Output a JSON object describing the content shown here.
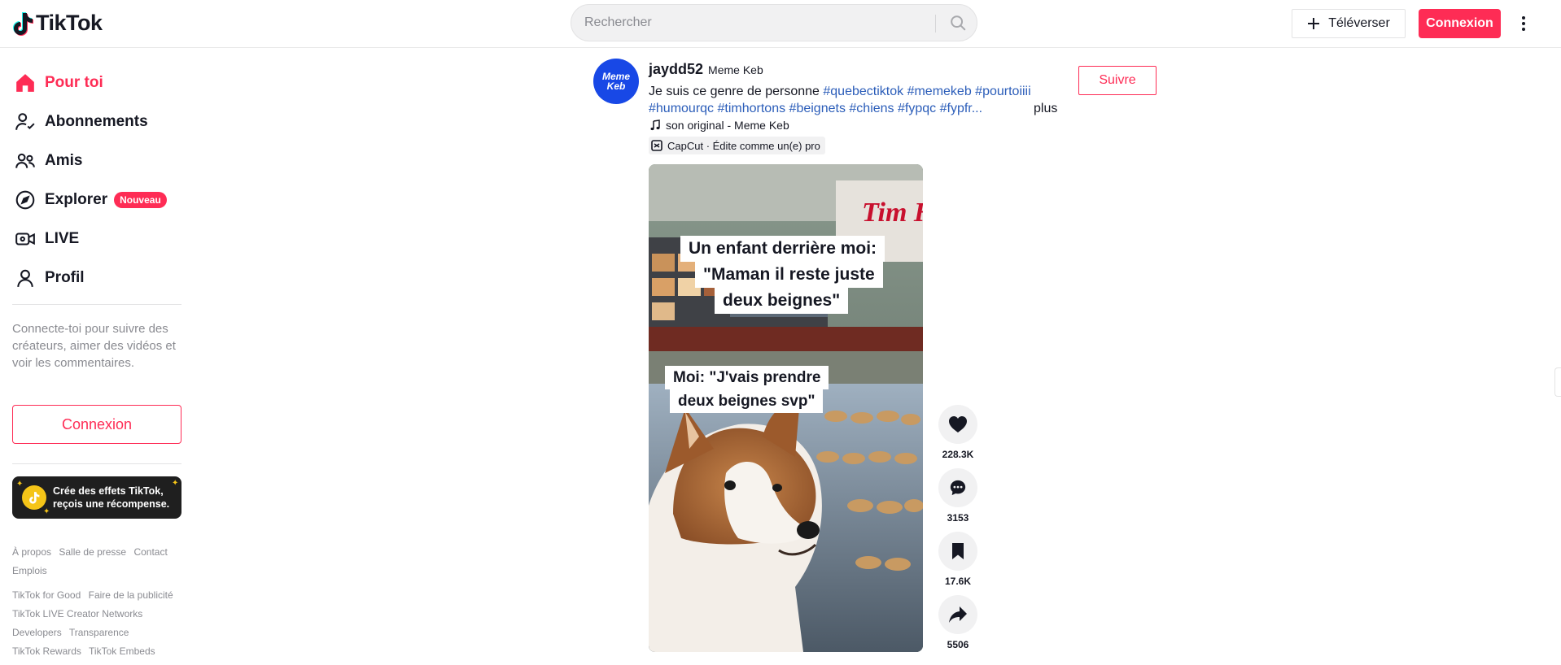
{
  "header": {
    "logo_text": "TikTok",
    "search_placeholder": "Rechercher",
    "upload_label": "Téléverser",
    "login_label": "Connexion"
  },
  "sidebar": {
    "nav": [
      {
        "label": "Pour toi",
        "icon": "home-icon",
        "active": true
      },
      {
        "label": "Abonnements",
        "icon": "following-icon"
      },
      {
        "label": "Amis",
        "icon": "friends-icon"
      },
      {
        "label": "Explorer",
        "icon": "compass-icon",
        "badge": "Nouveau"
      },
      {
        "label": "LIVE",
        "icon": "live-icon"
      },
      {
        "label": "Profil",
        "icon": "profile-icon"
      }
    ],
    "login_hint": "Connecte-toi pour suivre des créateurs, aimer des vidéos et voir les commentaires.",
    "login_button": "Connexion",
    "promo": "Crée des effets TikTok, reçois une récompense.",
    "footer": {
      "row1": [
        "À propos",
        "Salle de presse",
        "Contact",
        "Emplois"
      ],
      "row2": [
        "TikTok for Good",
        "Faire de la publicité",
        "TikTok LIVE Creator Networks",
        "Developers",
        "Transparence",
        "TikTok Rewards",
        "TikTok Embeds"
      ]
    }
  },
  "post": {
    "avatar_text": "Meme Keb",
    "author_id": "jaydd52",
    "author_nick": "Meme Keb",
    "desc_text": "Je suis ce genre de personne",
    "hashtags": [
      "#quebectiktok",
      "#memekeb",
      "#pourtoiiii",
      "#humourqc",
      "#timhortons",
      "#beignets",
      "#chiens",
      "#fypqc",
      "#fypfr..."
    ],
    "more_label": "plus",
    "music": "son original - Meme Keb",
    "capcut": "CapCut · Édite comme un(e) pro",
    "follow_label": "Suivre",
    "video": {
      "caption1": "Un enfant derrière moi: \"Maman il reste juste deux beignes\"",
      "caption1_lines": [
        "Un enfant derrière moi:",
        "\"Maman il reste juste",
        "deux beignes\""
      ],
      "caption2_lines": [
        "Moi: \"J'vais prendre",
        "deux beignes svp\""
      ],
      "sign_text": "Tim Ho"
    },
    "actions": {
      "likes": "228.3K",
      "comments": "3153",
      "saves": "17.6K",
      "shares": "5506"
    }
  },
  "colors": {
    "brand": "#fe2c55",
    "hashtag": "#2b5db9",
    "avatar_bg": "#1848e6"
  }
}
